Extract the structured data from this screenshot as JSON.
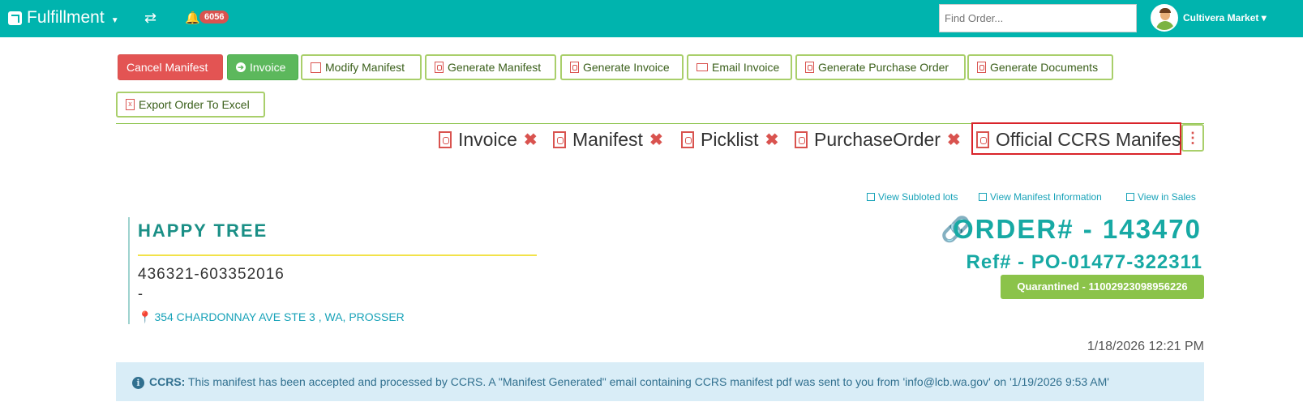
{
  "navbar": {
    "brand": "Fulfillment",
    "notification_count": "6056",
    "search_placeholder": "Find Order...",
    "user_name": "Cultivera Market"
  },
  "actions": {
    "cancel_manifest": "Cancel Manifest",
    "invoice": "Invoice",
    "modify_manifest": "Modify Manifest",
    "generate_manifest": "Generate Manifest",
    "generate_invoice": "Generate Invoice",
    "email_invoice": "Email Invoice",
    "generate_purchase_order": "Generate Purchase Order",
    "generate_documents": "Generate Documents",
    "export_order": "Export Order To Excel"
  },
  "documents": [
    {
      "label": "Invoice",
      "removable": true
    },
    {
      "label": "Manifest",
      "removable": true
    },
    {
      "label": "Picklist",
      "removable": true
    },
    {
      "label": "PurchaseOrder",
      "removable": true
    },
    {
      "label": "Official CCRS Manifest",
      "removable": false
    }
  ],
  "links": {
    "subloted": "View Subloted lots",
    "manifest_info": "View Manifest Information",
    "in_sales": "View in Sales"
  },
  "customer": {
    "name": "HAPPY TREE",
    "license": "436321-603352016",
    "dash": "-",
    "address": "354 CHARDONNAY AVE STE 3 , WA, PROSSER"
  },
  "order": {
    "number": "ORDER# - 143470",
    "ref": "Ref# - PO-01477-322311",
    "quarantine": "Quarantined - 11002923098956226",
    "timestamp": "1/18/2026 12:21 PM"
  },
  "alert": {
    "label": "CCRS:",
    "message": " This manifest has been accepted and processed by CCRS. A \"Manifest Generated\" email containing CCRS manifest pdf was sent to you from 'info@lcb.wa.gov' on '1/19/2026 9:53 AM'"
  },
  "colors": {
    "navbar": "#00b4ae",
    "danger": "#e35453",
    "success": "#5cb85c",
    "outline": "#a9cf6b",
    "teal_text": "#17a9a4",
    "alert_bg": "#d9edf7"
  }
}
